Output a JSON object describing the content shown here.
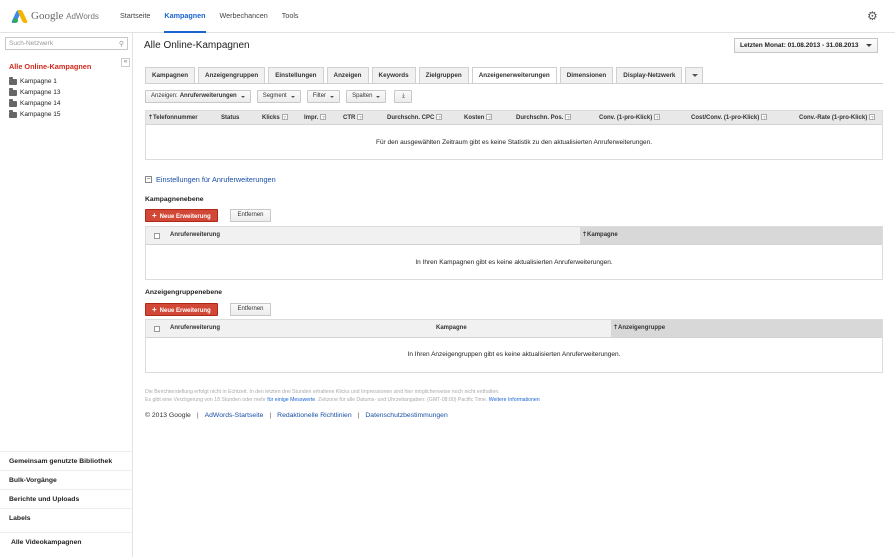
{
  "header": {
    "logo_google": "Google",
    "logo_adwords": "AdWords",
    "nav": [
      "Startseite",
      "Kampagnen",
      "Werbechancen",
      "Tools"
    ],
    "active_nav": "Kampagnen",
    "gear_icon": "gear-icon"
  },
  "sidebar": {
    "search_placeholder": "Such-Netzwerk",
    "collapse_label": "«",
    "all_campaigns": "Alle Online-Kampagnen",
    "campaigns": [
      "Kampagne 1",
      "Kampagne 13",
      "Kampagne 14",
      "Kampagne 15"
    ],
    "bottom_links": [
      "Gemeinsam genutzte Bibliothek",
      "Bulk-Vorgänge",
      "Berichte und Uploads",
      "Labels"
    ],
    "video_link": "Alle Videokampagnen"
  },
  "main": {
    "title": "Alle Online-Kampagnen",
    "daterange": "Letzten Monat: 01.08.2013 - 31.08.2013",
    "tabs": [
      "Kampagnen",
      "Anzeigengruppen",
      "Einstellungen",
      "Anzeigen",
      "Keywords",
      "Zielgruppen",
      "Anzeigenerweiterungen",
      "Dimensionen",
      "Display-Netzwerk"
    ],
    "active_tab": "Anzeigenerweiterungen",
    "toolbar": {
      "view_prefix": "Anzeigen:",
      "view_value": "Anrufer­weiterungen",
      "segment": "Segment",
      "filter": "Filter",
      "columns": "Spalten"
    },
    "stats_table": {
      "columns": [
        "Telefonnummer",
        "Status",
        "Klicks",
        "Impr.",
        "CTR",
        "Durchschn. CPC",
        "Kosten",
        "Durchschn. Pos.",
        "Conv. (1-pro-Klick)",
        "Cost/Conv. (1-pro-Klick)",
        "Conv.-Rate (1-pro-Klick)"
      ],
      "empty_message": "Für den ausgewählten Zeitraum gibt es keine Statistik zu den aktualisierten Anruferweiterungen."
    },
    "settings_toggle": "Einstellungen für Anruferweiterungen",
    "campaign_level": {
      "title": "Kampagnenebene",
      "add_button": "Neue Erweiterung",
      "remove_button": "Entfernen",
      "columns": [
        "Anruferweiterung",
        "Kampagne"
      ],
      "empty_message": "In Ihren Kampagnen gibt es keine aktualisierten Anruferweiterungen."
    },
    "adgroup_level": {
      "title": "Anzeigengruppenebene",
      "add_button": "Neue Erweiterung",
      "remove_button": "Entfernen",
      "columns": [
        "Anruferweiterung",
        "Kampagne",
        "Anzeigengruppe"
      ],
      "empty_message": "In Ihren Anzeigengruppen gibt es keine aktualisierten Anruferweiterungen."
    },
    "footer_note_line1": "Die Berichterstellung erfolgt nicht in Echtzeit. In den letzten drei Stunden erhaltene Klicks und Impressionen sind hier möglicherweise noch nicht enthalten.",
    "footer_note_line2": "Es gibt eine Verzögerung von 18 Stunden oder mehr",
    "footer_note_link1": "für einige Messwerte",
    "footer_note_line3": ". Zeitzone für alle Datums- und Uhrzeitangaben: (GMT-08:00) Pacific Time.",
    "footer_note_link2": "Weitere Informationen",
    "footer_copyright": "© 2013 Google",
    "footer_links": [
      "AdWords-Startseite",
      "Redaktionelle Richtlinien",
      "Datenschutzbestimmungen"
    ],
    "colors": {
      "accent_blue": "#1a64d2",
      "red": "#d14836",
      "sidebar_red": "#d2281c"
    }
  }
}
